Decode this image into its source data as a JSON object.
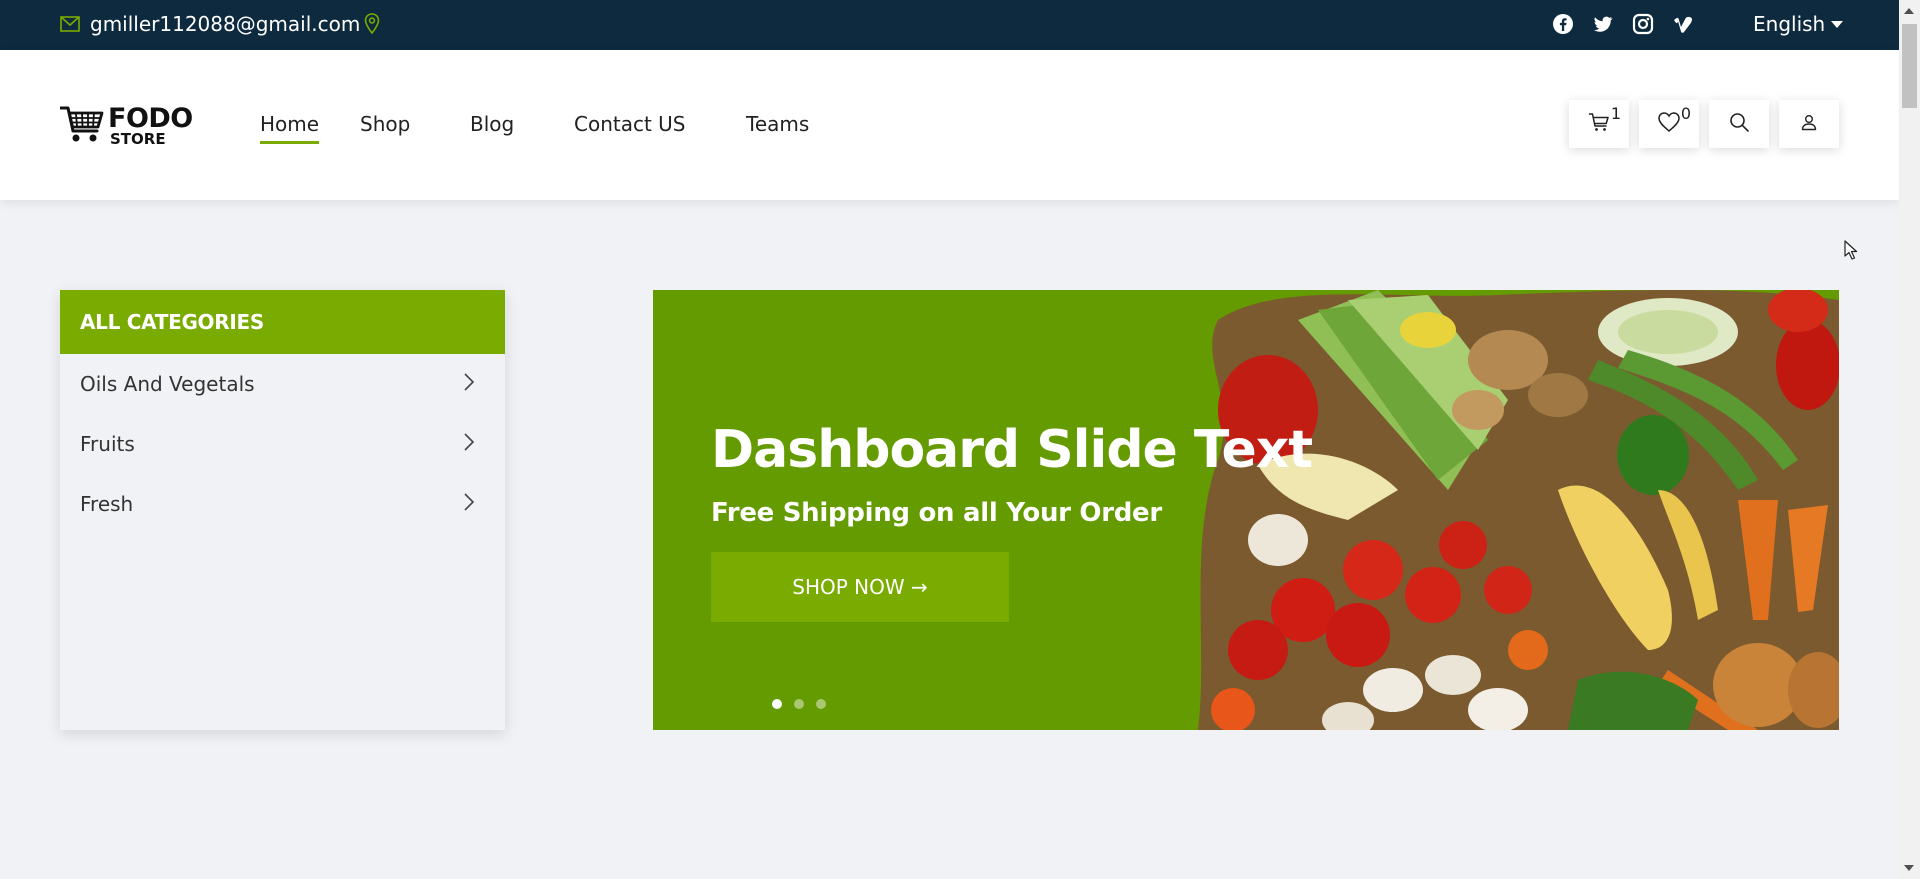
{
  "topbar": {
    "email": "gmiller112088@gmail.com",
    "socials": [
      "facebook-icon",
      "twitter-icon",
      "instagram-icon",
      "vimeo-icon"
    ],
    "language": "English"
  },
  "header": {
    "logo": {
      "line1": "FODO",
      "line2": "STORE"
    },
    "nav": [
      {
        "label": "Home",
        "active": true
      },
      {
        "label": "Shop",
        "active": false
      },
      {
        "label": "Blog",
        "active": false
      },
      {
        "label": "Contact US",
        "active": false
      },
      {
        "label": "Teams",
        "active": false
      }
    ],
    "cart_count": "1",
    "wishlist_count": "0"
  },
  "categories": {
    "title": "ALL CATEGORIES",
    "items": [
      "Oils And Vegetals",
      "Fruits",
      "Fresh"
    ]
  },
  "banner": {
    "title": "Dashboard Slide Text",
    "subtitle": "Free Shipping on all Your Order",
    "button": "SHOP NOW →",
    "slides": 3,
    "active_slide": 1
  },
  "colors": {
    "topbar": "#0d2a3e",
    "accent": "#7aab00",
    "banner_bg": "#649b00",
    "page_bg": "#f1f2f6"
  }
}
